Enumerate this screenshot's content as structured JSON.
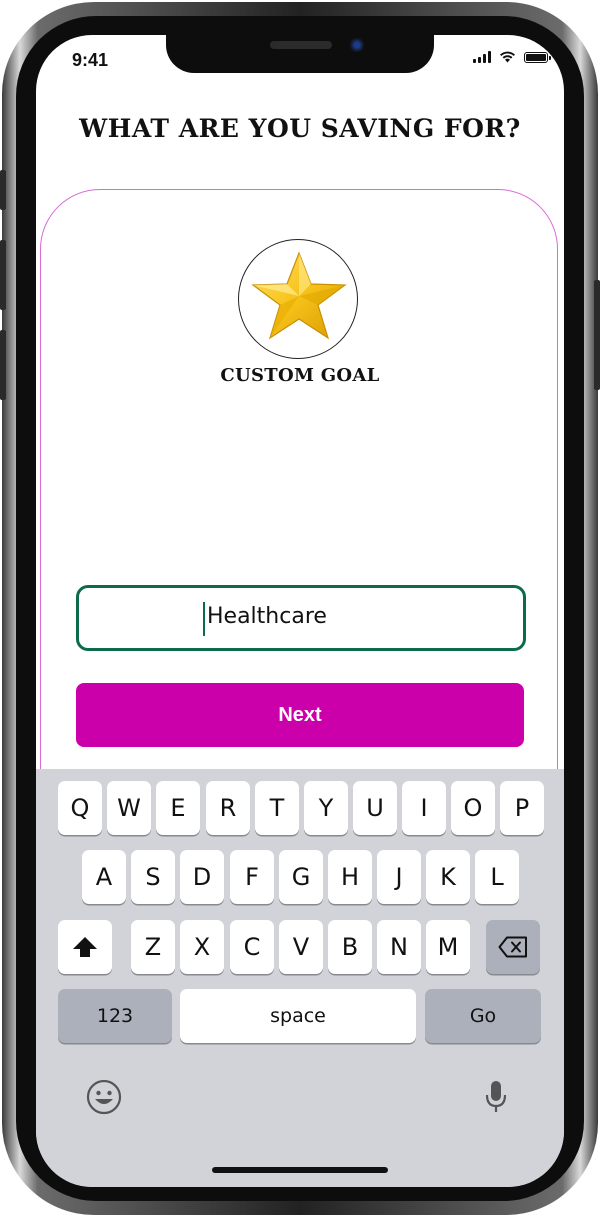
{
  "status_bar": {
    "time": "9:41"
  },
  "page": {
    "title": "WHAT ARE YOU SAVING FOR?"
  },
  "goal": {
    "label": "CUSTOM GOAL",
    "icon": "star-icon",
    "input_value": "Healthcare"
  },
  "actions": {
    "next_label": "Next"
  },
  "keyboard": {
    "row1": [
      "Q",
      "W",
      "E",
      "R",
      "T",
      "Y",
      "U",
      "I",
      "O",
      "P"
    ],
    "row2": [
      "A",
      "S",
      "D",
      "F",
      "G",
      "H",
      "J",
      "K",
      "L"
    ],
    "row3": [
      "Z",
      "X",
      "C",
      "V",
      "B",
      "N",
      "M"
    ],
    "numbers_label": "123",
    "space_label": "space",
    "go_label": "Go"
  },
  "colors": {
    "accent": "#CC00AA",
    "input_border": "#0B6B4A",
    "card_border": "#D96AD6",
    "keyboard_bg": "#D1D3D9"
  }
}
